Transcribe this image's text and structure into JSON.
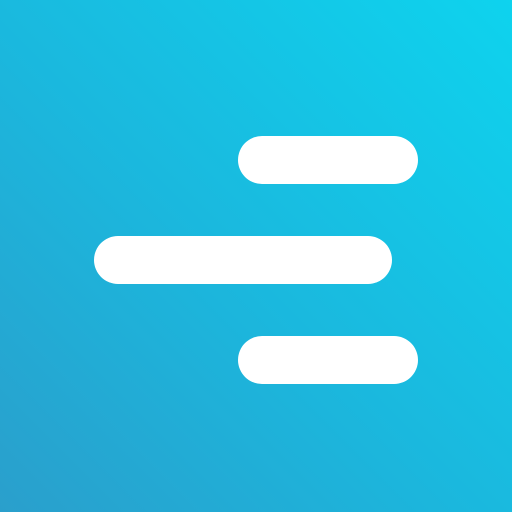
{
  "icon": {
    "semantic_name": "menu-lines-icon",
    "colors": {
      "gradient_start": "#0ED3EE",
      "gradient_mid": "#1BB7DD",
      "gradient_end": "#2A9FCC",
      "bar": "#FFFFFF"
    }
  }
}
